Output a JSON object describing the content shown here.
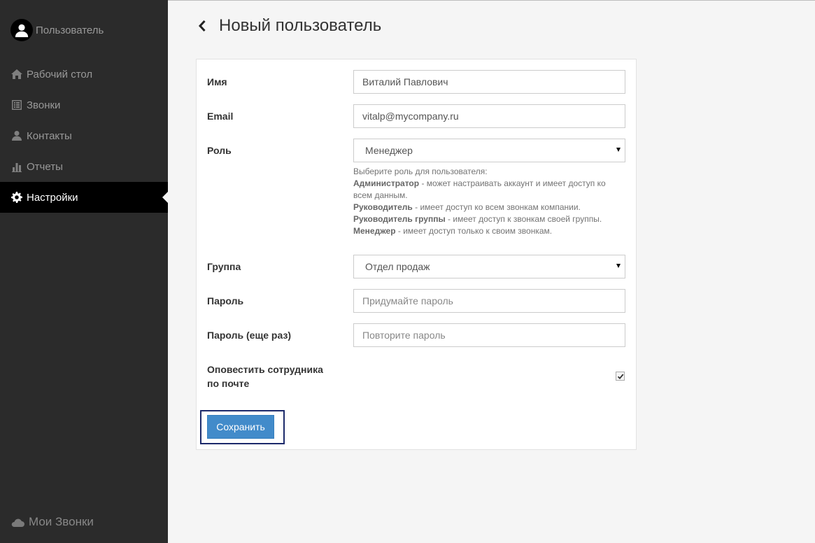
{
  "sidebar": {
    "user_label": "Пользователь",
    "items": [
      {
        "label": "Рабочий стол",
        "icon": "home-icon"
      },
      {
        "label": "Звонки",
        "icon": "list-icon"
      },
      {
        "label": "Контакты",
        "icon": "person-icon"
      },
      {
        "label": "Отчеты",
        "icon": "bar-chart-icon"
      },
      {
        "label": "Настройки",
        "icon": "gear-icon",
        "active": true
      }
    ],
    "brand": "Мои Звонки"
  },
  "header": {
    "title": "Новый пользователь"
  },
  "form": {
    "name": {
      "label": "Имя",
      "value": "Виталий Павлович"
    },
    "email": {
      "label": "Email",
      "value": "vitalp@mycompany.ru"
    },
    "role": {
      "label": "Роль",
      "value": "Менеджер",
      "help_intro": "Выберите роль для пользователя:",
      "help": [
        {
          "term": "Администратор",
          "text": " - может настраивать аккаунт и имеет доступ ко всем данным."
        },
        {
          "term": "Руководитель",
          "text": " - имеет доступ ко всем звонкам компании."
        },
        {
          "term": "Руководитель группы",
          "text": " - имеет доступ к звонкам своей группы."
        },
        {
          "term": "Менеджер",
          "text": " - имеет доступ только к своим звонкам."
        }
      ]
    },
    "group": {
      "label": "Группа",
      "value": "Отдел продаж"
    },
    "password": {
      "label": "Пароль",
      "placeholder": "Придумайте пароль"
    },
    "password_repeat": {
      "label": "Пароль (еще раз)",
      "placeholder": "Повторите пароль"
    },
    "notify": {
      "label_line1": "Оповестить сотрудника",
      "label_line2": "по почте",
      "checked": true
    },
    "save_label": "Сохранить"
  },
  "colors": {
    "sidebar_bg": "#2b2b2b",
    "active_bg": "#000000",
    "primary_button": "#428bca"
  }
}
